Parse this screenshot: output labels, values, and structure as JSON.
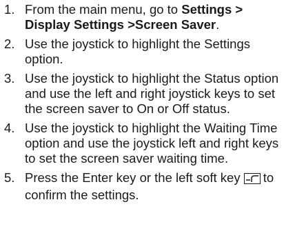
{
  "steps": [
    {
      "number": "1.",
      "text_before": "From the main menu, go to ",
      "path_part1": "Settings > Display Settings >",
      "path_part2": "Screen Saver",
      "text_after": "."
    },
    {
      "number": "2.",
      "text": "Use the joystick to highlight the Settings option."
    },
    {
      "number": "3.",
      "text": "Use the joystick to highlight the Status option and use the left and right joystick keys to set the screen saver to On or Off status."
    },
    {
      "number": "4.",
      "text": "Use the joystick to highlight the Waiting Time option and use the joystick left and right keys to set the screen saver waiting time."
    },
    {
      "number": "5.",
      "text_before": "Press the Enter key or the left soft key",
      "text_after": "to confirm the settings.",
      "icon": "left-soft-key-icon"
    }
  ]
}
